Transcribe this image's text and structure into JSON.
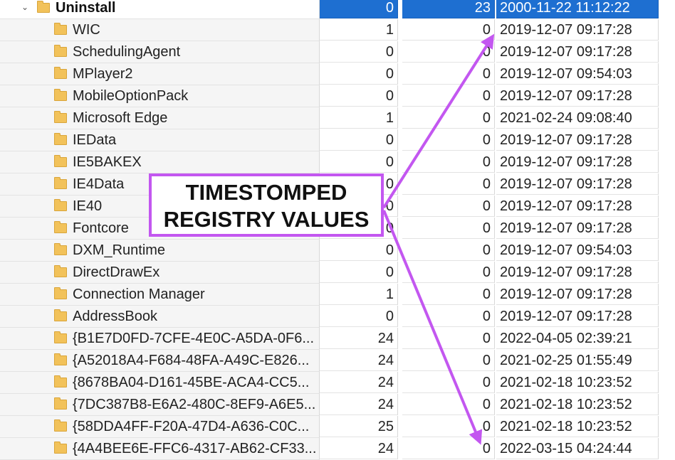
{
  "rows": [
    {
      "name": "Uninstall",
      "a": "0",
      "b": "23",
      "date": "2000-11-22 11:12:22",
      "selected": true
    },
    {
      "name": "WIC",
      "a": "1",
      "b": "0",
      "date": "2019-12-07 09:17:28"
    },
    {
      "name": "SchedulingAgent",
      "a": "0",
      "b": "0",
      "date": "2019-12-07 09:17:28"
    },
    {
      "name": "MPlayer2",
      "a": "0",
      "b": "0",
      "date": "2019-12-07 09:54:03"
    },
    {
      "name": "MobileOptionPack",
      "a": "0",
      "b": "0",
      "date": "2019-12-07 09:17:28"
    },
    {
      "name": "Microsoft Edge",
      "a": "1",
      "b": "0",
      "date": "2021-02-24 09:08:40"
    },
    {
      "name": "IEData",
      "a": "0",
      "b": "0",
      "date": "2019-12-07 09:17:28"
    },
    {
      "name": "IE5BAKEX",
      "a": "0",
      "b": "0",
      "date": "2019-12-07 09:17:28"
    },
    {
      "name": "IE4Data",
      "a": "0",
      "b": "0",
      "date": "2019-12-07 09:17:28"
    },
    {
      "name": "IE40",
      "a": "0",
      "b": "0",
      "date": "2019-12-07 09:17:28"
    },
    {
      "name": "Fontcore",
      "a": "0",
      "b": "0",
      "date": "2019-12-07 09:17:28"
    },
    {
      "name": "DXM_Runtime",
      "a": "0",
      "b": "0",
      "date": "2019-12-07 09:54:03"
    },
    {
      "name": "DirectDrawEx",
      "a": "0",
      "b": "0",
      "date": "2019-12-07 09:17:28"
    },
    {
      "name": "Connection Manager",
      "a": "1",
      "b": "0",
      "date": "2019-12-07 09:17:28"
    },
    {
      "name": "AddressBook",
      "a": "0",
      "b": "0",
      "date": "2019-12-07 09:17:28"
    },
    {
      "name": "{B1E7D0FD-7CFE-4E0C-A5DA-0F6...",
      "a": "24",
      "b": "0",
      "date": "2022-04-05 02:39:21"
    },
    {
      "name": "{A52018A4-F684-48FA-A49C-E826...",
      "a": "24",
      "b": "0",
      "date": "2021-02-25 01:55:49"
    },
    {
      "name": "{8678BA04-D161-45BE-ACA4-CC5...",
      "a": "24",
      "b": "0",
      "date": "2021-02-18 10:23:52"
    },
    {
      "name": "{7DC387B8-E6A2-480C-8EF9-A6E5...",
      "a": "24",
      "b": "0",
      "date": "2021-02-18 10:23:52"
    },
    {
      "name": "{58DDA4FF-F20A-47D4-A636-C0C...",
      "a": "25",
      "b": "0",
      "date": "2021-02-18 10:23:52"
    },
    {
      "name": "{4A4BEE6E-FFC6-4317-AB62-CF33...",
      "a": "24",
      "b": "0",
      "date": "2022-03-15 04:24:44"
    }
  ],
  "callout": {
    "line1": "TIMESTOMPED",
    "line2": "REGISTRY VALUES"
  },
  "colors": {
    "selection": "#1e6fd1",
    "annotation": "#c357f0",
    "folder": "#f2c25a"
  },
  "icons": {
    "folder": "folder-icon",
    "expand": "chevron-down-icon"
  }
}
